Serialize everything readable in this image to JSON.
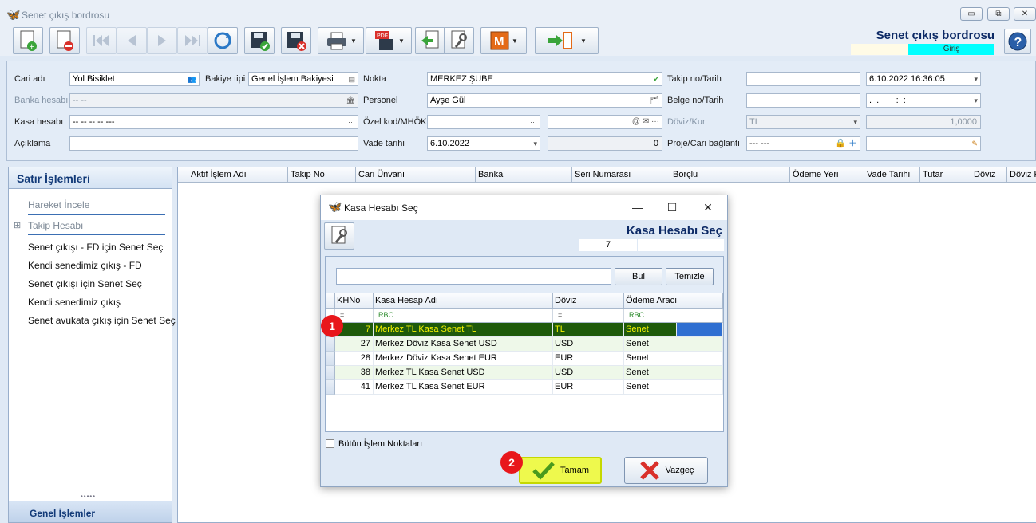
{
  "window": {
    "title": "Senet çıkış bordrosu",
    "min_glyph": "▭",
    "restore_glyph": "⧉",
    "close_glyph": "✕"
  },
  "header": {
    "form_title": "Senet çıkış bordrosu",
    "mode": "Giriş"
  },
  "form": {
    "cari_adi": {
      "label": "Cari adı",
      "value": "Yol Bisiklet"
    },
    "bakiye_tipi": {
      "label": "Bakiye tipi",
      "value": "Genel İşlem Bakiyesi"
    },
    "nokta": {
      "label": "Nokta",
      "value": "MERKEZ ŞUBE"
    },
    "takip_no": {
      "label": "Takip no/Tarih",
      "value": "",
      "date": "6.10.2022 16:36:05"
    },
    "banka_hesabi": {
      "label": "Banka hesabı",
      "value": "-- --"
    },
    "personel": {
      "label": "Personel",
      "value": "Ayşe Gül"
    },
    "belge_no": {
      "label": "Belge no/Tarih",
      "value": "",
      "date": ".  .       :  :"
    },
    "kasa_hesabi": {
      "label": "Kasa hesabı",
      "value": "-- -- -- -- ---"
    },
    "ozel_kod": {
      "label": "Özel kod/MHÖK",
      "value": ""
    },
    "doviz_kur": {
      "label": "Döviz/Kur",
      "currency": "TL",
      "rate": "1,0000"
    },
    "aciklama": {
      "label": "Açıklama",
      "value": ""
    },
    "vade_tarihi": {
      "label": "Vade tarihi",
      "value": "6.10.2022",
      "days": "0"
    },
    "proje": {
      "label": "Proje/Cari bağlantı",
      "value": "--- ---"
    }
  },
  "left_panel": {
    "title": "Satır İşlemleri",
    "items": [
      "Hareket İncele",
      "Takip Hesabı",
      "Senet çıkışı - FD için Senet Seç",
      "Kendi senedimiz çıkış - FD",
      "Senet çıkışı için Senet Seç",
      "Kendi senedimiz çıkış",
      "Senet avukata çıkış için Senet Seç"
    ],
    "footer": "Genel İşlemler"
  },
  "grid": {
    "columns": [
      "Aktif İşlem Adı",
      "Takip No",
      "Cari Ünvanı",
      "Banka",
      "Seri Numarası",
      "Borçlu",
      "Ödeme Yeri",
      "Vade Tarihi",
      "Tutar",
      "Döviz",
      "Döviz K"
    ]
  },
  "dialog": {
    "title": "Kasa Hesabı Seç",
    "heading": "Kasa Hesabı Seç",
    "count": "7",
    "search_value": "",
    "find_label": "Bul",
    "clear_label": "Temizle",
    "columns": [
      "KHNo",
      "Kasa Hesap Adı",
      "Döviz",
      "Ödeme Aracı"
    ],
    "filter_row": [
      "=",
      "RBC",
      "=",
      "RBC"
    ],
    "rows": [
      {
        "no": "7",
        "name": "Merkez TL Kasa Senet TL",
        "doviz": "TL",
        "arac": "Senet"
      },
      {
        "no": "27",
        "name": "Merkez Döviz Kasa Senet USD",
        "doviz": "USD",
        "arac": "Senet"
      },
      {
        "no": "28",
        "name": "Merkez Döviz Kasa Senet EUR",
        "doviz": "EUR",
        "arac": "Senet"
      },
      {
        "no": "38",
        "name": "Merkez TL Kasa Senet USD",
        "doviz": "USD",
        "arac": "Senet"
      },
      {
        "no": "41",
        "name": "Merkez TL Kasa Senet EUR",
        "doviz": "EUR",
        "arac": "Senet"
      }
    ],
    "all_points_label": "Bütün İşlem Noktaları",
    "ok_label": "Tamam",
    "cancel_label": "Vazgeç",
    "min_glyph": "—",
    "max_glyph": "☐",
    "close_glyph": "✕"
  },
  "markers": [
    "1",
    "2"
  ],
  "colors": {
    "selected_row_bg": "#1e5a0b",
    "selected_row_fg": "#f5f200",
    "highlight_btn": "#eef94d",
    "mode_badge": "#00ffff",
    "title_color": "#0d2a66",
    "marker": "#e8171b"
  }
}
